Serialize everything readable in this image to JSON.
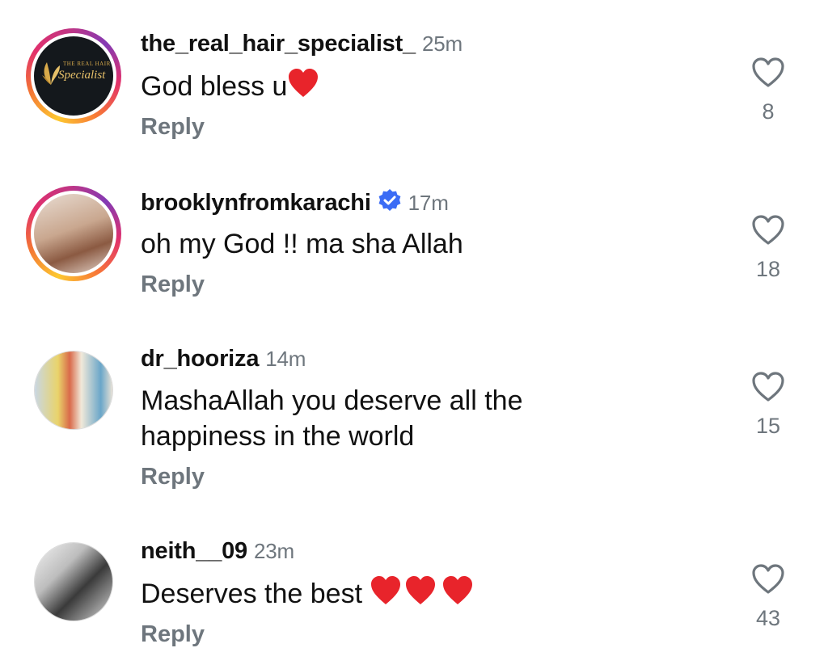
{
  "comments": [
    {
      "username": "the_real_hair_specialist_",
      "time": "25m",
      "text": "God bless u",
      "emoji": "heart",
      "reply_label": "Reply",
      "likes": "8",
      "avatar": {
        "logo_small": "THE REAL HAIR",
        "logo_main": "Specialist"
      }
    },
    {
      "username": "brooklynfromkarachi",
      "verified": true,
      "time": "17m",
      "text": "oh my God !! ma sha Allah",
      "reply_label": "Reply",
      "likes": "18"
    },
    {
      "username": "dr_hooriza",
      "time": "14m",
      "text": "MashaAllah you deserve all the happiness in the world",
      "reply_label": "Reply",
      "likes": "15"
    },
    {
      "username": "neith__09",
      "time": "23m",
      "text": "Deserves the best",
      "emoji": "heart x3",
      "reply_label": "Reply",
      "likes": "43"
    }
  ],
  "colors": {
    "text": "#111111",
    "muted": "#6e767d",
    "heart": "#e8242b",
    "verified": "#3b6cf5"
  },
  "icons": {
    "like": "heart-outline-icon",
    "verified": "verified-badge-icon",
    "emoji": "red-heart-emoji"
  }
}
